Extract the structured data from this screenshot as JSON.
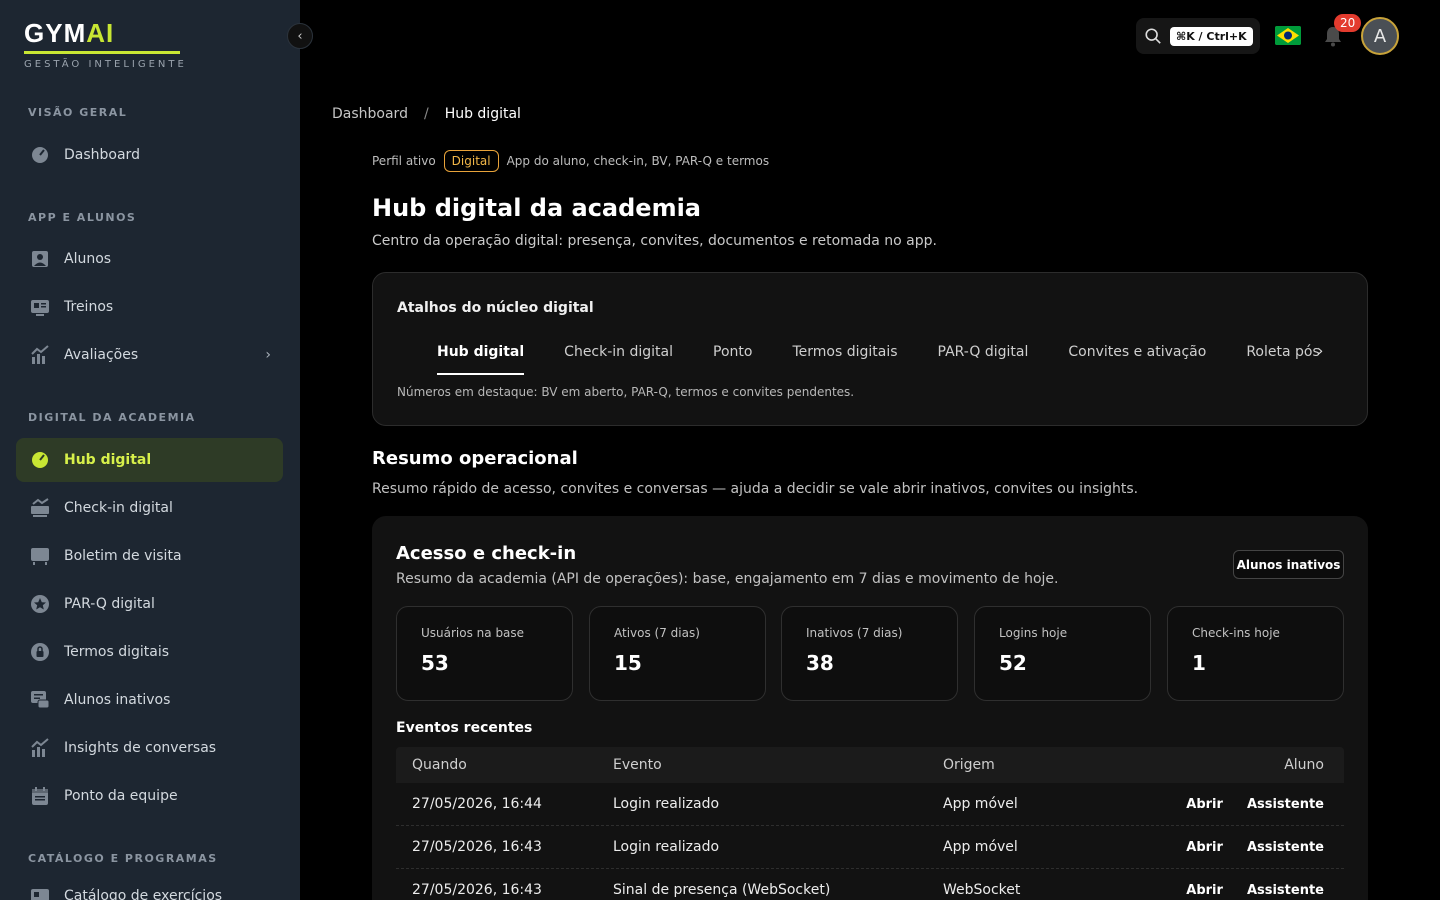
{
  "brand": {
    "name_main": "GYM",
    "name_accent": "AI",
    "tagline": "GESTÃO INTELIGENTE"
  },
  "sidebar": {
    "sections": [
      {
        "label": "VISÃO GERAL"
      },
      {
        "label": "APP E ALUNOS"
      },
      {
        "label": "DIGITAL DA ACADEMIA"
      },
      {
        "label": "CATÁLOGO E PROGRAMAS"
      }
    ],
    "items": [
      {
        "label": "Dashboard",
        "icon": "gauge-icon"
      },
      {
        "label": "Alunos",
        "icon": "user-icon"
      },
      {
        "label": "Treinos",
        "icon": "clipboard-icon"
      },
      {
        "label": "Avaliações",
        "icon": "chart-icon"
      },
      {
        "label": "Hub digital",
        "icon": "gauge-icon"
      },
      {
        "label": "Check-in digital",
        "icon": "checkin-icon"
      },
      {
        "label": "Boletim de visita",
        "icon": "monitor-icon"
      },
      {
        "label": "PAR-Q digital",
        "icon": "star-badge-icon"
      },
      {
        "label": "Termos digitais",
        "icon": "lock-icon"
      },
      {
        "label": "Alunos inativos",
        "icon": "chat-icon"
      },
      {
        "label": "Insights de conversas",
        "icon": "chart-icon"
      },
      {
        "label": "Ponto da equipe",
        "icon": "calendar-icon"
      },
      {
        "label": "Catálogo de exercícios",
        "icon": "clipboard-icon"
      }
    ]
  },
  "topbar": {
    "shortcut": "⌘K / Ctrl+K",
    "notifications": "20",
    "avatar_initial": "A"
  },
  "breadcrumb": {
    "root": "Dashboard",
    "sep": "/",
    "current": "Hub digital"
  },
  "profile": {
    "label": "Perfil ativo",
    "pill": "Digital",
    "desc": "App do aluno, check-in, BV, PAR-Q e termos"
  },
  "page": {
    "title": "Hub digital da academia",
    "subtitle": "Centro da operação digital: presença, convites, documentos e retomada no app."
  },
  "shortcuts": {
    "title": "Atalhos do núcleo digital",
    "tabs": [
      "Hub digital",
      "Check-in digital",
      "Ponto",
      "Termos digitais",
      "PAR-Q digital",
      "Convites e ativação",
      "Roleta pós-v"
    ],
    "note": "Números em destaque: BV em aberto, PAR-Q, termos e convites pendentes."
  },
  "summary": {
    "title": "Resumo operacional",
    "subtitle": "Resumo rápido de acesso, convites e conversas — ajuda a decidir se vale abrir inativos, convites ou insights."
  },
  "access": {
    "title": "Acesso e check-in",
    "subtitle": "Resumo da academia (API de operações): base, engajamento em 7 dias e movimento de hoje.",
    "button": "Alunos inativos",
    "stats": [
      {
        "label": "Usuários na base",
        "value": "53"
      },
      {
        "label": "Ativos (7 dias)",
        "value": "15"
      },
      {
        "label": "Inativos (7 dias)",
        "value": "38"
      },
      {
        "label": "Logins hoje",
        "value": "52"
      },
      {
        "label": "Check-ins hoje",
        "value": "1"
      }
    ],
    "events_title": "Eventos recentes",
    "columns": [
      "Quando",
      "Evento",
      "Origem",
      "Aluno"
    ],
    "rows": [
      {
        "when": "27/05/2026, 16:44",
        "event": "Login realizado",
        "origin": "App móvel",
        "open": "Abrir",
        "student": "Assistente"
      },
      {
        "when": "27/05/2026, 16:43",
        "event": "Login realizado",
        "origin": "App móvel",
        "open": "Abrir",
        "student": "Assistente"
      },
      {
        "when": "27/05/2026, 16:43",
        "event": "Sinal de presença (WebSocket)",
        "origin": "WebSocket",
        "open": "Abrir",
        "student": "Assistente"
      }
    ]
  },
  "colors": {
    "accent": "#c8e633",
    "sidebar_bg": "#1d2631",
    "pill": "#e8a33a"
  }
}
